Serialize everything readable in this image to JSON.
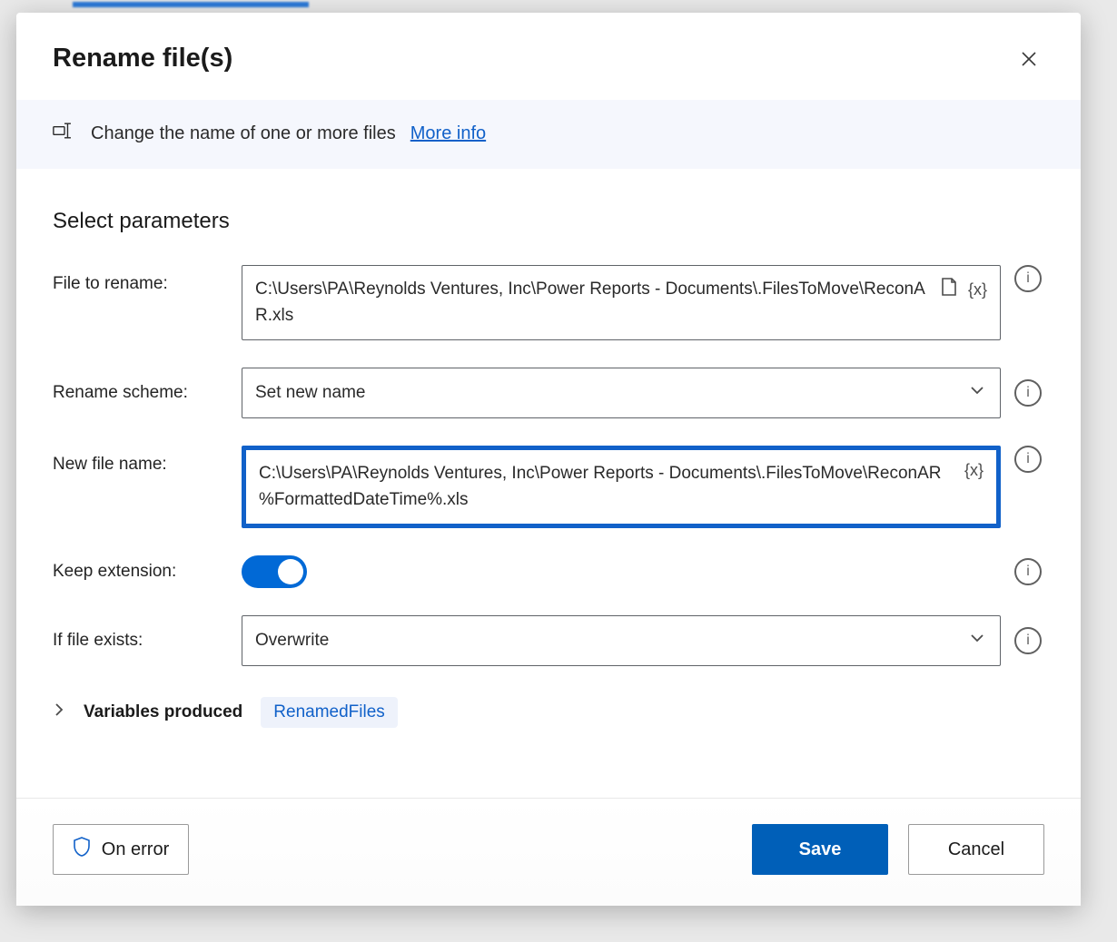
{
  "dialog": {
    "title": "Rename file(s)",
    "banner": {
      "text": "Change the name of one or more files",
      "link": "More info"
    },
    "section_title": "Select parameters",
    "fields": {
      "file_to_rename": {
        "label": "File to rename:",
        "value": "C:\\Users\\PA\\Reynolds Ventures, Inc\\Power Reports - Documents\\.FilesToMove\\ReconAR.xls"
      },
      "rename_scheme": {
        "label": "Rename scheme:",
        "value": "Set new name"
      },
      "new_file_name": {
        "label": "New file name:",
        "value": "C:\\Users\\PA\\Reynolds Ventures, Inc\\Power Reports - Documents\\.FilesToMove\\ReconAR %FormattedDateTime%.xls"
      },
      "keep_extension": {
        "label": "Keep extension:",
        "enabled": true
      },
      "if_file_exists": {
        "label": "If file exists:",
        "value": "Overwrite"
      }
    },
    "variables_produced": {
      "label": "Variables produced",
      "chip": "RenamedFiles"
    },
    "footer": {
      "on_error": "On error",
      "save": "Save",
      "cancel": "Cancel"
    },
    "icons": {
      "variable_brace": "{x}"
    }
  }
}
